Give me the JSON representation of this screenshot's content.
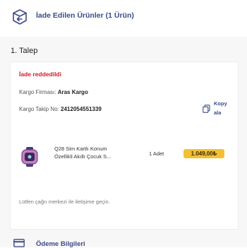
{
  "header": {
    "icon": "return-box-icon",
    "title": "İade Edilen Ürünler (1 Ürün)"
  },
  "request": {
    "title": "1. Talep",
    "status": "İade reddedildi",
    "cargo_company_label": "Kargo Firması:",
    "cargo_company": "Aras Kargo",
    "tracking_label": "Kargo Takip No:",
    "tracking_no": "2412054551339",
    "copy_label": "Kopyala",
    "copy_icon": "copy-icon"
  },
  "product": {
    "image_icon": "smartwatch-image",
    "name_line1": "Q28 Sim Kartlı Konum",
    "name_line2": "Özellikli Akıllı Çocuk S...",
    "quantity": "1 Adet",
    "price": "1.049,00₺"
  },
  "info_text": "Lütfen çağrı merkezi ile iletişime geçin.",
  "payment": {
    "icon": "credit-card-icon",
    "title": "Ödeme Bilgileri"
  },
  "colors": {
    "accent": "#3d4a87",
    "status_red": "#d11a2a",
    "price_bg": "#f3c033"
  }
}
